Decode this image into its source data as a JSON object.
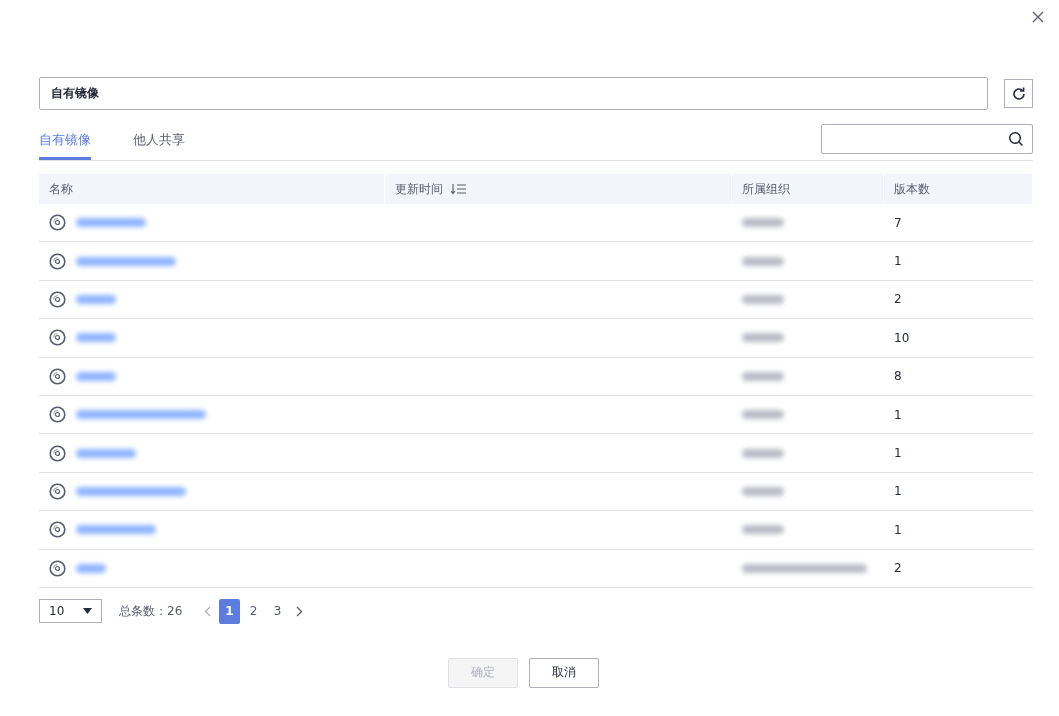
{
  "image_field": {
    "value": "自有镜像"
  },
  "tabs": [
    {
      "label": "自有镜像",
      "selected": true
    },
    {
      "label": "他人共享",
      "selected": false
    }
  ],
  "table": {
    "columns": [
      {
        "label": "名称",
        "sortable": false
      },
      {
        "label": "更新时间",
        "sortable": true
      },
      {
        "label": "所属组织",
        "sortable": false
      },
      {
        "label": "版本数",
        "sortable": false
      }
    ],
    "rows": [
      {
        "versions": "7"
      },
      {
        "versions": "1"
      },
      {
        "versions": "2"
      },
      {
        "versions": "10"
      },
      {
        "versions": "8"
      },
      {
        "versions": "1"
      },
      {
        "versions": "1"
      },
      {
        "versions": "1"
      },
      {
        "versions": "1"
      },
      {
        "versions": "2"
      }
    ]
  },
  "pagination": {
    "page_size": "10",
    "total": "总条数：26",
    "pages": [
      {
        "label": "1",
        "selected": true
      },
      {
        "label": "2",
        "selected": false
      },
      {
        "label": "3",
        "selected": false
      }
    ]
  },
  "buttons": [
    {
      "label": "确定",
      "disabled": true
    },
    {
      "label": "取消",
      "disabled": false
    }
  ]
}
